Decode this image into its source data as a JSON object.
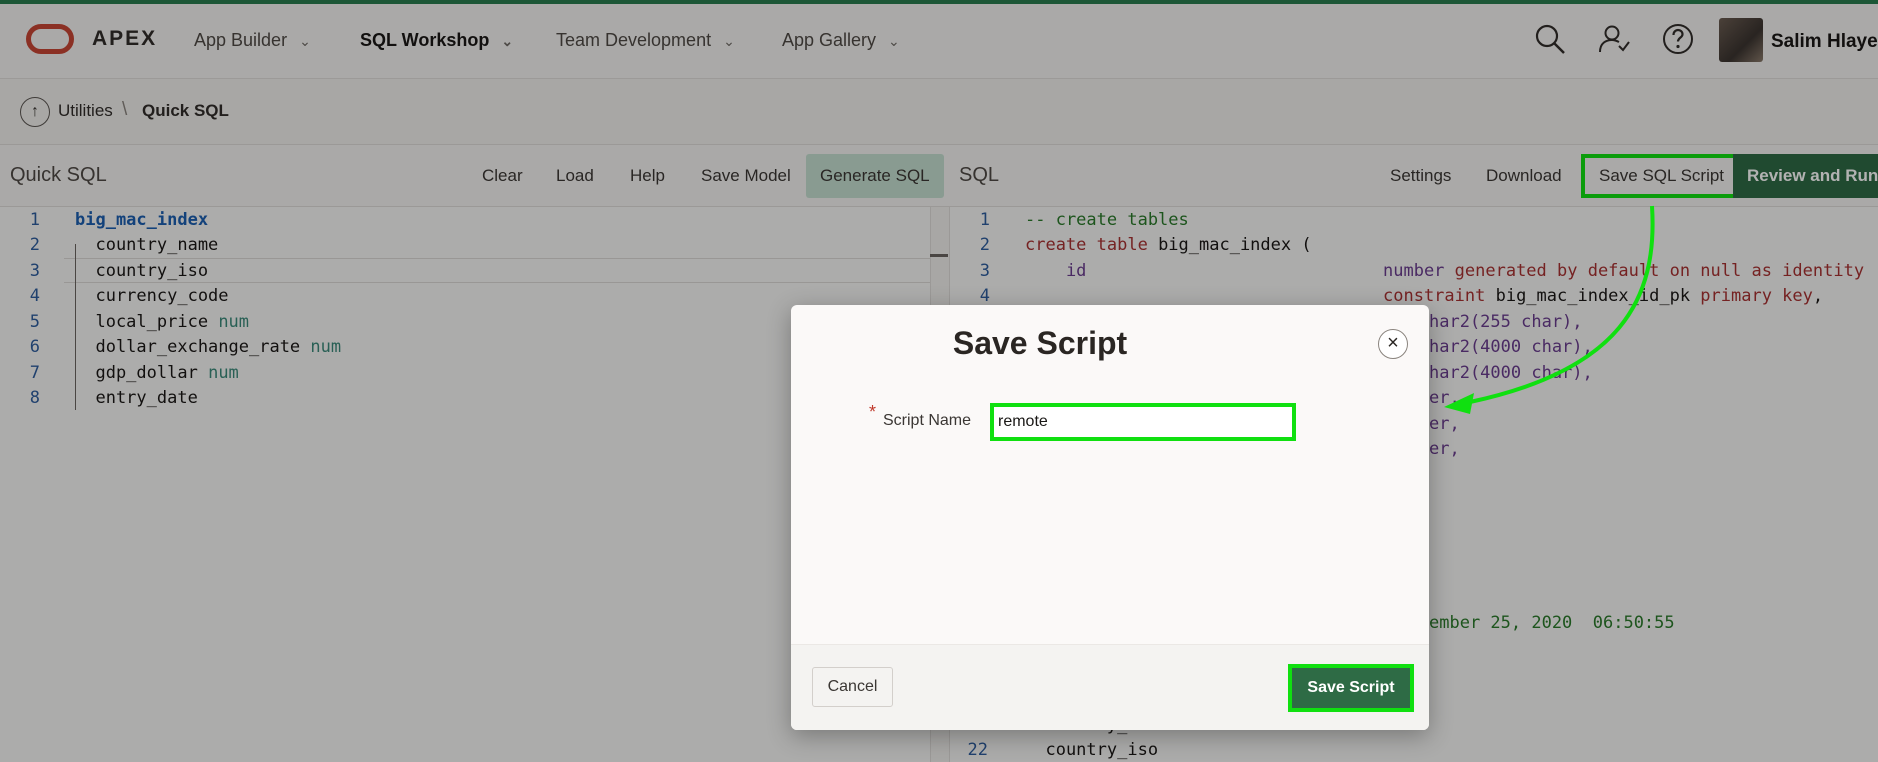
{
  "nav": {
    "brand": "APEX",
    "items": [
      {
        "label": "App Builder",
        "active": false
      },
      {
        "label": "SQL Workshop",
        "active": true
      },
      {
        "label": "Team Development",
        "active": false
      },
      {
        "label": "App Gallery",
        "active": false
      }
    ],
    "user": "Salim Hlayel"
  },
  "breadcrumb": {
    "parent": "Utilities",
    "current": "Quick SQL"
  },
  "toolbar": {
    "left_title": "Quick SQL",
    "left_buttons": [
      "Clear",
      "Load",
      "Help",
      "Save Model",
      "Generate SQL"
    ],
    "right_title": "SQL",
    "right_buttons": [
      "Settings",
      "Download",
      "Save SQL Script",
      "Review and Run"
    ]
  },
  "left_editor": {
    "lines": [
      {
        "n": "1",
        "text": "big_mac_index",
        "type": ""
      },
      {
        "n": "2",
        "text": "  country_name",
        "type": ""
      },
      {
        "n": "3",
        "text": "  country_iso",
        "type": ""
      },
      {
        "n": "4",
        "text": "  currency_code",
        "type": ""
      },
      {
        "n": "5",
        "text": "  local_price",
        "type": "num"
      },
      {
        "n": "6",
        "text": "  dollar_exchange_rate",
        "type": "num"
      },
      {
        "n": "7",
        "text": "  gdp_dollar",
        "type": "num"
      },
      {
        "n": "8",
        "text": "  entry_date",
        "type": ""
      }
    ]
  },
  "right_editor": {
    "line_numbers": [
      "1",
      "2",
      "3",
      "4",
      "22"
    ],
    "l1": "-- create tables",
    "l2_kw": "create table",
    "l2_rest": " big_mac_index (",
    "l3_col": "    id",
    "l3_def_a": "number ",
    "l3_def_b": "generated by default on null as identity",
    "l4_a": "constraint",
    "l4_b": " big_mac_index_id_pk ",
    "l4_c": "primary key",
    "l4_d": ",",
    "v1": "har2(255 char),",
    "v2": "har2(4000 char),",
    "v3": "har2(4000 char),",
    "v4": "er,",
    "v5": "er,",
    "v6": "er,",
    "date_text": "ember 25, 2020  06:50:55",
    "l21": "  country_name",
    "l22": "  country_iso"
  },
  "dialog": {
    "title": "Save Script",
    "required_mark": "*",
    "field_label": "Script Name",
    "field_value": "remote",
    "cancel_label": "Cancel",
    "save_label": "Save Script"
  },
  "colors": {
    "accent": "#2e6b45",
    "highlight": "#10e010",
    "oracle_red": "#c74634"
  }
}
